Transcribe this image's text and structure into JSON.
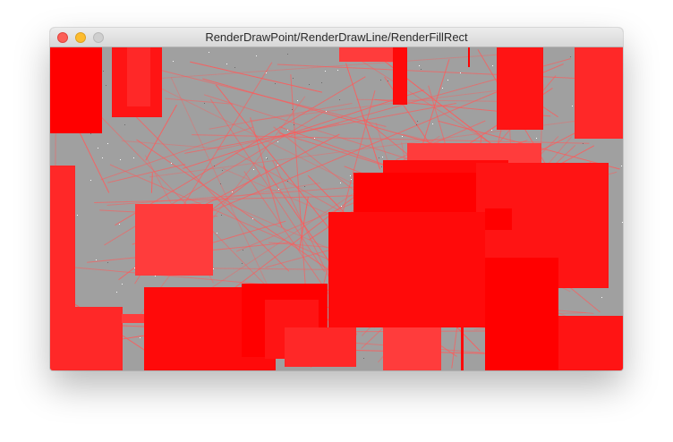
{
  "window": {
    "title": "RenderDrawPoint/RenderDrawLine/RenderFillRect"
  },
  "colors": {
    "canvas_background": "#a0a0a0",
    "line_color": "#ff5a5a",
    "rect_colors": [
      "#ff0000",
      "#ff1414",
      "#ff2828",
      "#ff3c3c",
      "#ff0a0a"
    ]
  },
  "icons": {
    "close": "close-dot-icon",
    "minimize": "minimize-dot-icon",
    "zoom": "zoom-dot-icon"
  }
}
